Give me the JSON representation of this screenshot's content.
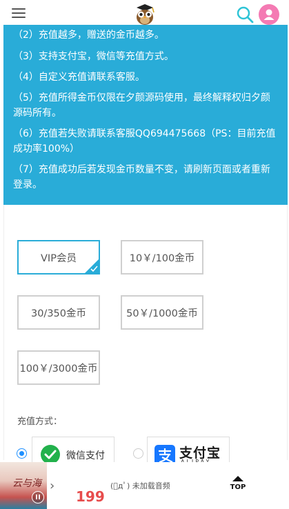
{
  "notice": {
    "lines": [
      "（2）充值越多，赠送的金币越多。",
      "（3）支持支付宝，微信等充值方式。",
      "（4）自定义充值请联系客服。",
      "（5）充值所得金币仅限在夕颜源码使用，最终解释权归夕颜源码所有。",
      "（6）充值若失败请联系客服QQ694475668（PS：目前充值成功率100%）",
      "（7）充值成功后若发现金币数量不变，请刷新页面或者重新登录。"
    ]
  },
  "options": {
    "vip": "VIP会员",
    "opt2": "10￥/100金币",
    "opt3": "30/350金币",
    "opt4": "50￥/1000金币",
    "opt5": "100￥/3000金币",
    "selected": "vip"
  },
  "payment": {
    "label": "充值方式：",
    "wechat": "微信支付",
    "alipay_cn": "支付宝",
    "alipay_en": "ALIPAY",
    "selected": "wechat"
  },
  "player": {
    "album_text": "云与海",
    "price": "199",
    "status": "(ﾟдﾟ) 未加载音频",
    "top_label": "TOP"
  },
  "colors": {
    "accent": "#29acd8",
    "price": "#e74c4c",
    "avatar": "#f47ab3",
    "search": "#2ec4d6",
    "wechat": "#22b14c",
    "alipay": "#1677ff"
  },
  "icons": [
    "menu-icon",
    "owl-logo",
    "search-icon",
    "user-icon",
    "check-icon",
    "wechat-icon",
    "alipay-icon",
    "pause-icon",
    "chevron-right-icon",
    "arrow-up-icon"
  ]
}
